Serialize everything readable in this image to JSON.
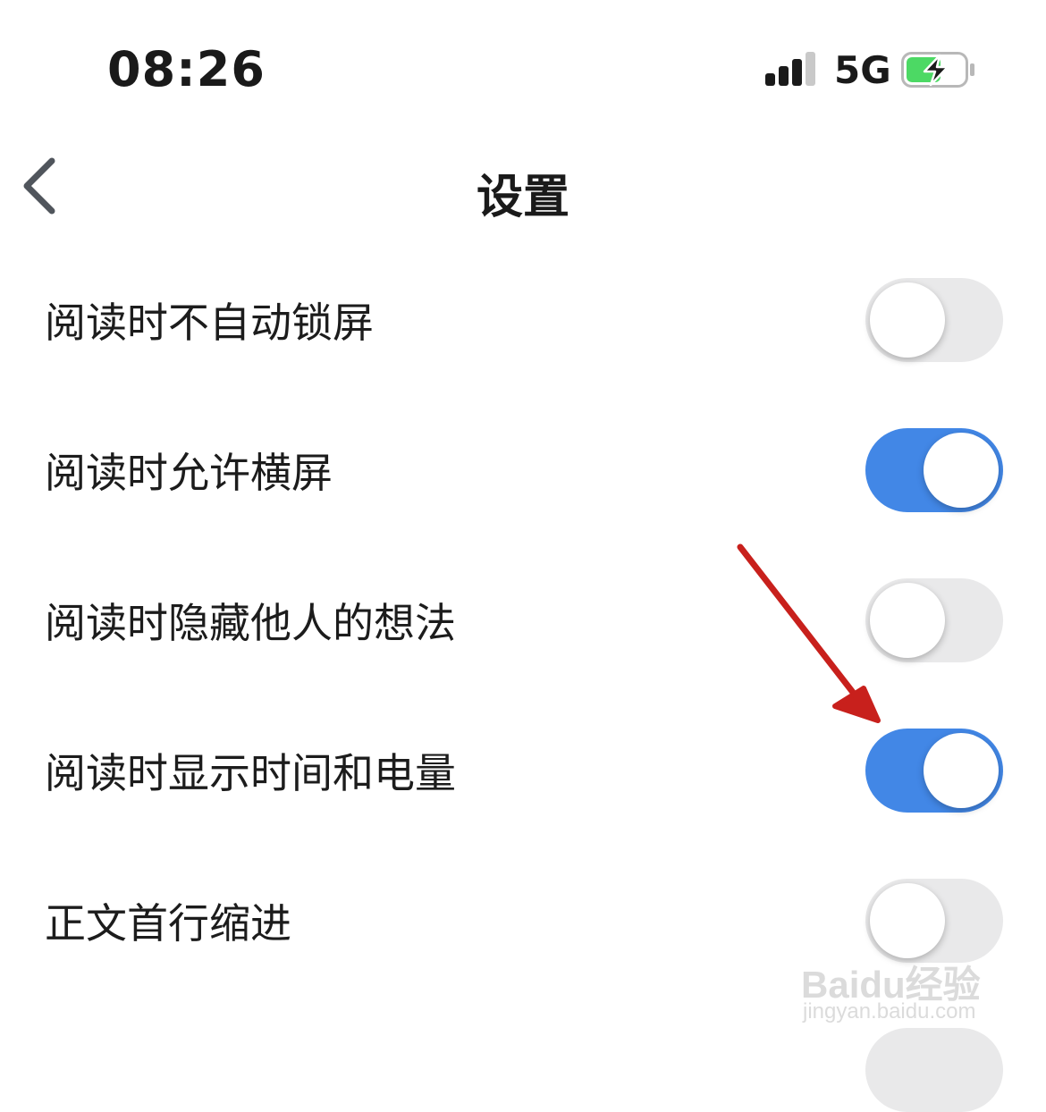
{
  "status_bar": {
    "time": "08:26",
    "network": "5G",
    "signal_bars_filled": 3,
    "signal_bars_total": 4,
    "battery_charging": true,
    "battery_color": "#4cd964"
  },
  "nav": {
    "back_icon": "chevron-left-icon",
    "title": "设置"
  },
  "settings": [
    {
      "label": "阅读时不自动锁屏",
      "enabled": false
    },
    {
      "label": "阅读时允许横屏",
      "enabled": true
    },
    {
      "label": "阅读时隐藏他人的想法",
      "enabled": false
    },
    {
      "label": "阅读时显示时间和电量",
      "enabled": true
    },
    {
      "label": "正文首行缩进",
      "enabled": false
    }
  ],
  "colors": {
    "toggle_on": "#4287e6",
    "toggle_off": "#e9e9ea",
    "annotation_arrow": "#c8201c"
  },
  "annotation": {
    "icon": "red-arrow-icon"
  },
  "watermark": {
    "main": "Baidu经验",
    "sub": "jingyan.baidu.com"
  }
}
